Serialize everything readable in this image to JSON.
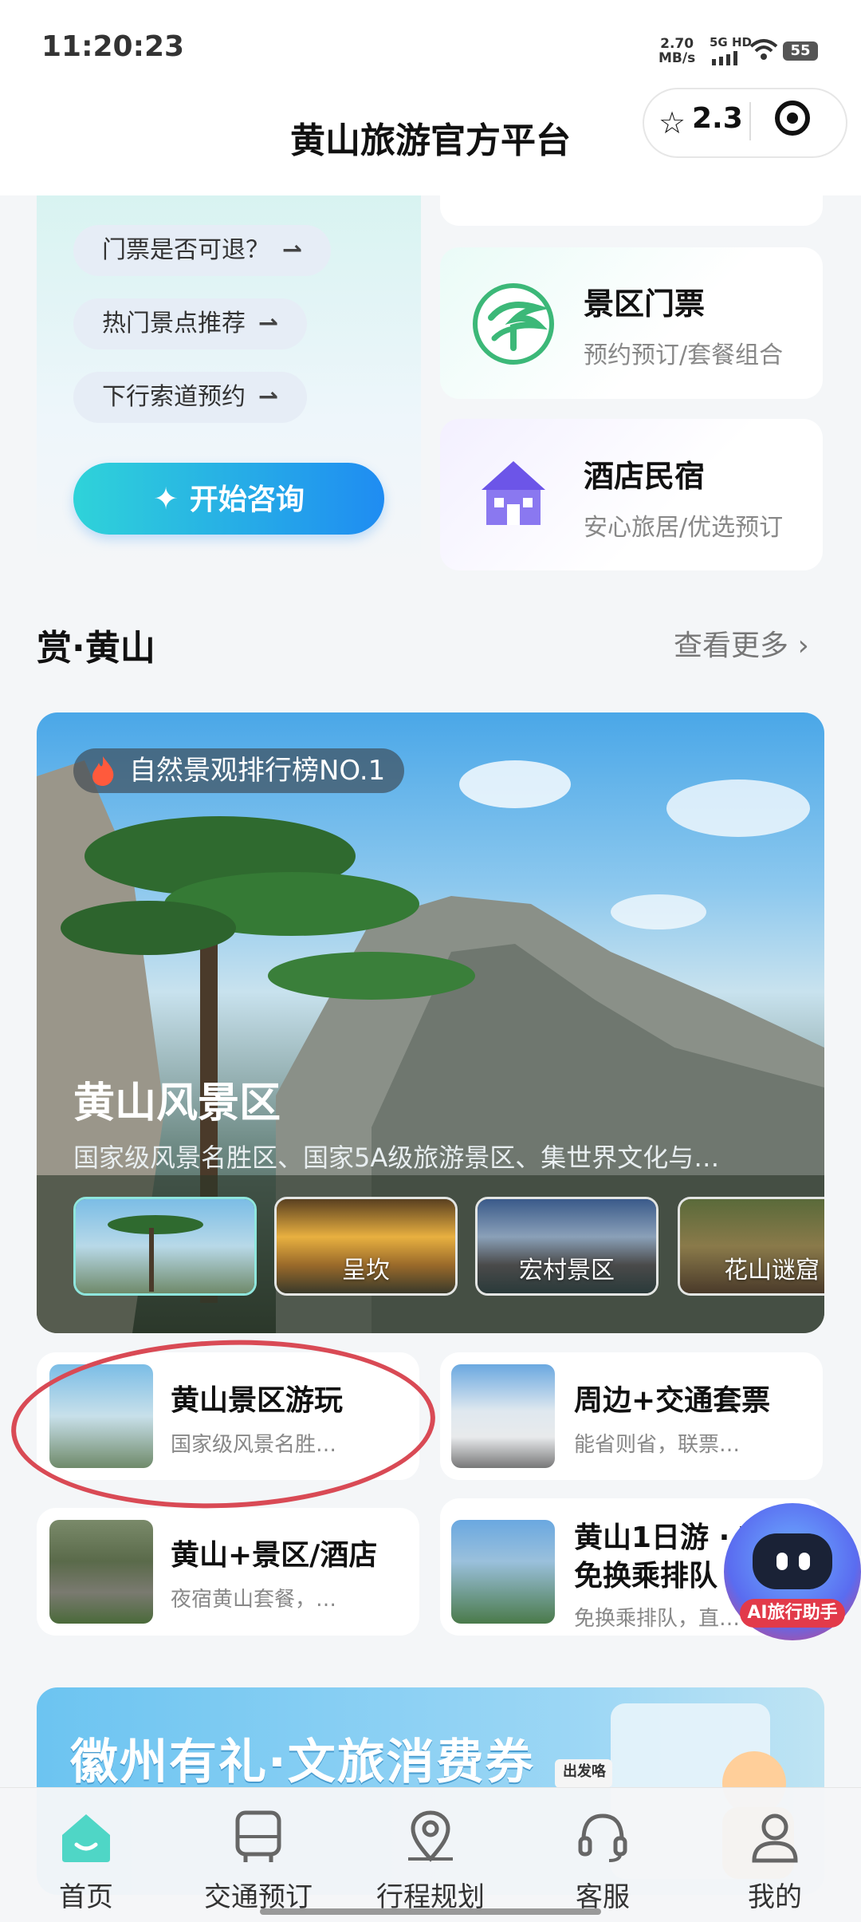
{
  "status_bar": {
    "time": "11:20:23",
    "net_speed": "2.70",
    "net_unit": "MB/s",
    "signal_label": "5G HD",
    "battery": "55"
  },
  "header": {
    "title": "黄山旅游官方平台",
    "rating": "2.3"
  },
  "consult": {
    "chips": [
      {
        "label": "门票是否可退？",
        "arrow": "⇀"
      },
      {
        "label": "热门景点推荐",
        "arrow": "⇀"
      },
      {
        "label": "下行索道预约",
        "arrow": "⇀"
      }
    ],
    "start_button": "开始咨询"
  },
  "services": [
    {
      "title": "景区门票",
      "subtitle": "预约预订/套餐组合",
      "icon": "tree-icon"
    },
    {
      "title": "酒店民宿",
      "subtitle": "安心旅居/优选预订",
      "icon": "house-icon"
    }
  ],
  "section": {
    "title": "赏·黄山",
    "more": "查看更多"
  },
  "hero": {
    "badge": "自然景观排行榜NO.1",
    "name": "黄山风景区",
    "description": "国家级风景名胜区、国家5A级旅游景区、集世界文化与…",
    "thumbs": [
      {
        "label": ""
      },
      {
        "label": "呈坎"
      },
      {
        "label": "宏村景区"
      },
      {
        "label": "花山谜窟"
      }
    ]
  },
  "products": [
    {
      "title": "黄山景区游玩",
      "subtitle": "国家级风景名胜…"
    },
    {
      "title": "周边+交通套票",
      "subtitle": "能省则省，联票…"
    },
    {
      "title": "黄山+景区/酒店",
      "subtitle": "夜宿黄山套餐，…"
    },
    {
      "title": "黄山1日游 · V",
      "title2": "免换乘排队",
      "subtitle": "免换乘排队，直…"
    }
  ],
  "ai_helper": {
    "label": "AI旅行助手"
  },
  "banner": {
    "text": "徽州有礼·文旅消费券",
    "sign": "出发咯"
  },
  "tabbar": {
    "tabs": [
      {
        "label": "首页",
        "icon": "home-icon"
      },
      {
        "label": "交通预订",
        "icon": "bus-icon"
      },
      {
        "label": "行程规划",
        "icon": "map-pin-icon"
      },
      {
        "label": "客服",
        "icon": "headset-icon"
      },
      {
        "label": "我的",
        "icon": "user-icon"
      }
    ]
  }
}
